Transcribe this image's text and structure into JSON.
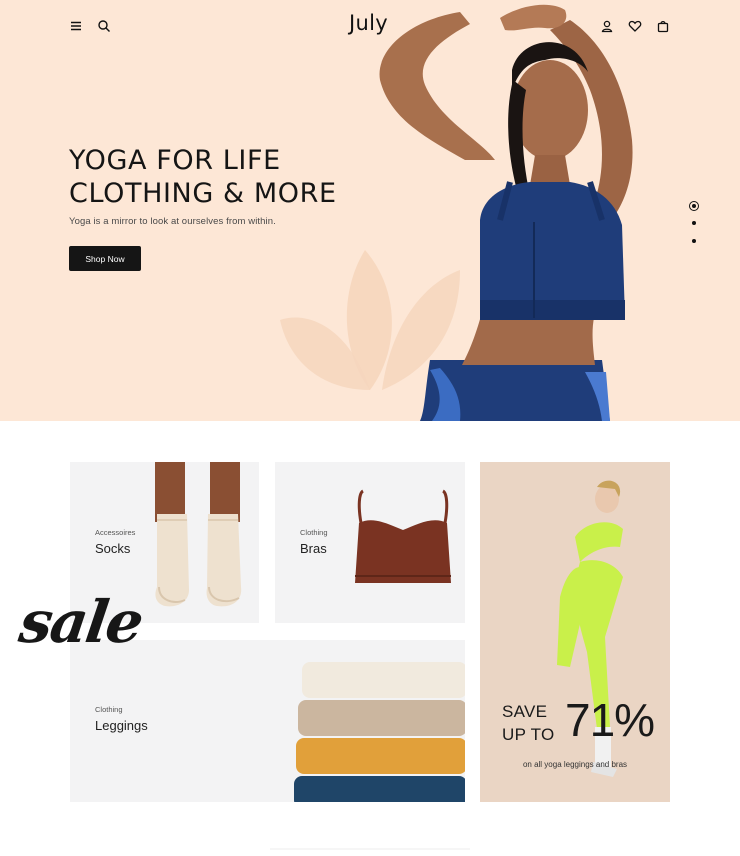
{
  "header": {
    "logo": "July",
    "icons": [
      "menu-icon",
      "search-icon",
      "user-icon",
      "heart-icon",
      "bag-icon"
    ]
  },
  "hero": {
    "title_line1": "YOGA FOR LIFE",
    "title_line2": "CLOTHING & MORE",
    "subtitle": "Yoga is a mirror to look at ourselves from within.",
    "cta_label": "Shop Now",
    "slides_total": 3,
    "active_slide": 1
  },
  "categories": [
    {
      "kicker": "Accessoires",
      "title": "Socks"
    },
    {
      "kicker": "Clothing",
      "title": "Bras"
    },
    {
      "kicker": "Clothing",
      "title": "Leggings"
    }
  ],
  "promo": {
    "sale_word": "sale",
    "save_line1": "SAVE",
    "save_line2": "UP TO",
    "percent": "71%",
    "note": "on all yoga leggings and bras"
  },
  "colors": {
    "hero_bg": "#fde7d6",
    "card_bg": "#f3f3f4",
    "promo_bg": "#ead5c4",
    "button_bg": "#151515",
    "top_bg": "#1f3d7a",
    "bra_color": "#7a3322",
    "legging_green": "#c9f04a"
  }
}
